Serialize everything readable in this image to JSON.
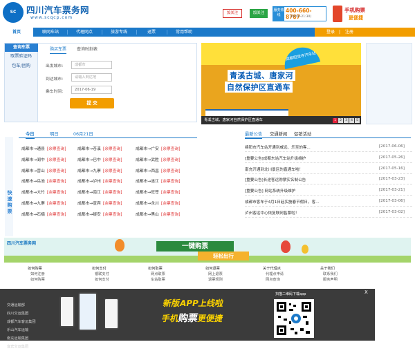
{
  "header": {
    "logo_text": "四川汽车票务网",
    "logo_url": "www.scqcp.com",
    "weibo": "加关注",
    "weixin": "加关注",
    "hotline_label": "服务热线",
    "hotline": "400-660-8787",
    "hotline_hours": "(08:00-21:30)",
    "mobile_title": "手机购票",
    "mobile_sub": "更便捷"
  },
  "nav": {
    "items": [
      "首页",
      "联网车站",
      "代理网点",
      "旅游专线",
      "退票",
      "常用帮助"
    ],
    "login": "登录",
    "register": "注册"
  },
  "query": {
    "tab": "查询车票",
    "side": [
      "取票验证码",
      "包车/团购"
    ],
    "subtabs": [
      "购买车票",
      "查询时刻表"
    ],
    "from_label": "出发城市:",
    "from_placeholder": "成都市",
    "to_label": "到达城市:",
    "to_placeholder": "请输入到达地",
    "date_label": "乘车时间:",
    "date_value": "2017-06-19",
    "submit": "提 交"
  },
  "banner": {
    "badge": "成都昭觉寺汽车站",
    "title1": "青溪古城、唐家河",
    "title2": "自然保护区直通车",
    "caption": "青溪古城、唐家河自然保护区直通车",
    "pages": [
      "1",
      "2",
      "3",
      "4",
      "5"
    ]
  },
  "schedule": {
    "vertical": "快速购票",
    "tabs": [
      "今日",
      "明日",
      "06月21日"
    ],
    "query_link": "[余票查询]",
    "rows": [
      [
        "成都市→通县",
        "成都市→苍溪",
        "成都市→广安"
      ],
      [
        "成都市→阆中",
        "成都市→巴中",
        "成都市→武胜"
      ],
      [
        "成都市→营山",
        "成都市→九寨",
        "成都市→西昌"
      ],
      [
        "成都市→岳池",
        "成都市→泸州",
        "成都市→遂江"
      ],
      [
        "成都市→大竹",
        "成都市→南江",
        "成都市→旺苍"
      ],
      [
        "成都市→九寨",
        "成都市→宣宾",
        "成都市→永川"
      ],
      [
        "成都市→石楠",
        "成都市→疑安",
        "成都市→黑山"
      ]
    ]
  },
  "news": {
    "tabs": [
      "最新公告",
      "交通新闻",
      "促销活动"
    ],
    "items": [
      {
        "title": "绵阳市汽车站开通到威远、乐至的客...",
        "date": "[2017-06-06]"
      },
      {
        "title": "[重要公告]成都东站汽车站升级维护",
        "date": "[2017-05-26]"
      },
      {
        "title": "南充开通到北川景区的直通车啦！",
        "date": "[2017-05-16]"
      },
      {
        "title": "[重要公告]长途客运购票实名制公告",
        "date": "[2017-03-23]"
      },
      {
        "title": "[重要公告] 网站系统升级维护",
        "date": "[2017-03-21]"
      },
      {
        "title": "成都市客车于4月1日起实施春节假日，客...",
        "date": "[2017-03-06]"
      },
      {
        "title": "泸州客运中心恢复联网售票啦！",
        "date": "[2017-03-02]"
      }
    ]
  },
  "banner2": {
    "logo": "四川汽车票务网",
    "title": "一键购票",
    "sub": "轻松出行"
  },
  "footer": {
    "cols": [
      {
        "title": "如何购票",
        "items": [
          "如何注册",
          "如何购票"
        ]
      },
      {
        "title": "如何支付",
        "items": [
          "银联支付",
          "如何支付"
        ]
      },
      {
        "title": "如何取票",
        "items": [
          "网点取票",
          "车站取票"
        ]
      },
      {
        "title": "如何退票",
        "items": [
          "网上退票",
          "退票规则"
        ]
      },
      {
        "title": "关于代理点",
        "items": [
          "代理点申请",
          "网点查询"
        ]
      },
      {
        "title": "关于我们",
        "items": [
          "联系我们",
          "服务声明"
        ]
      }
    ],
    "links": [
      "交通运输部",
      "四川交运集团",
      "成都汽车客运集团",
      "乐山汽车运输",
      "南充运输集团",
      "宜宾交运集团"
    ]
  },
  "app_ad": {
    "close": "X",
    "line1": "新版APP上线啦",
    "line2a": "手机",
    "line2b": "购票",
    "line2c": "更便捷",
    "qr_caption": "扫描二维码下载app"
  },
  "colors": {
    "brand": "#1b79c9",
    "accent": "#f29d00",
    "warn": "#e03b3b"
  }
}
